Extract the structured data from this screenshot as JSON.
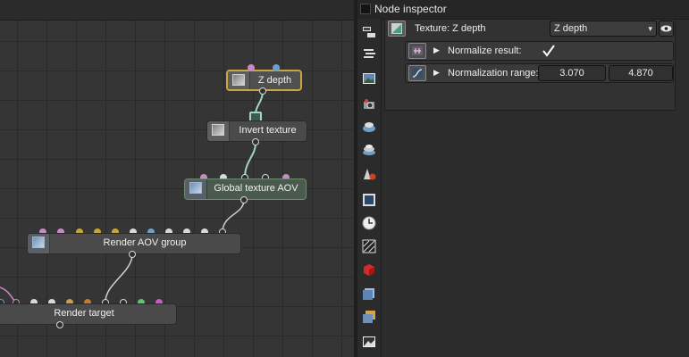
{
  "graph": {
    "nodes": {
      "z_depth": {
        "label": "Z depth"
      },
      "invert_texture": {
        "label": "Invert texture"
      },
      "global_texture_aov": {
        "label": "Global texture AOV"
      },
      "render_aov_group": {
        "label": "Render AOV group"
      },
      "render_target": {
        "label": "Render target"
      }
    }
  },
  "inspector": {
    "title": "Node inspector",
    "texture_label": "Texture: Z depth",
    "texture_dropdown": "Z depth",
    "normalize_label": "Normalize result:",
    "normalize_checked": true,
    "normalization_label": "Normalization range:",
    "range_min": "3.070",
    "range_max": "4.870"
  },
  "toolbar": {
    "icons": [
      "node-graph-icon",
      "stack-icon",
      "image-icon",
      "camera-icon",
      "environment-icon",
      "kernel-icon",
      "material-icon",
      "render-region-icon",
      "clock-icon",
      "texture-icon",
      "red-cube-icon",
      "blue-cube-icon",
      "layered-cube-icon",
      "picture-icon"
    ]
  },
  "colors": {
    "selected_border": "#c7a840",
    "wire": "#9fd6c2",
    "pin_pink": "#c88ac4",
    "pin_blue": "#6f9fc7",
    "pin_yellow": "#c6a438",
    "pin_green": "#5fc46e",
    "pin_orange": "#c67a28",
    "pin_magenta": "#c65ac6"
  }
}
